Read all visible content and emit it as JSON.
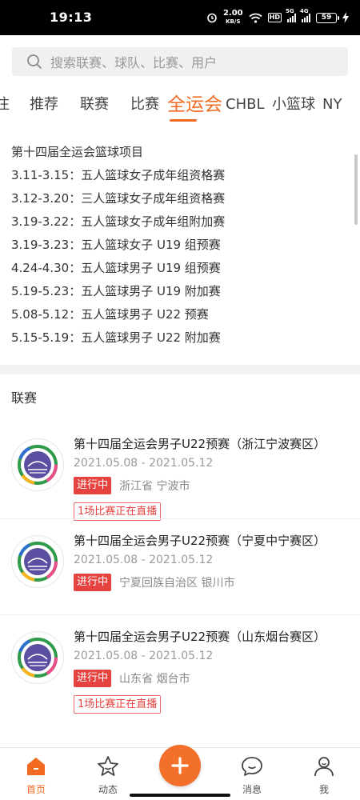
{
  "status_bar": {
    "time": "19:13",
    "speed_value": "2.00",
    "speed_unit": "KB/S",
    "hd": "HD",
    "sig1": "5G",
    "sig2": "4G",
    "battery": "59"
  },
  "search": {
    "placeholder": "搜索联赛、球队、比赛、用户"
  },
  "tabs": [
    {
      "label": "注",
      "active": false
    },
    {
      "label": "推荐",
      "active": false
    },
    {
      "label": "联赛",
      "active": false
    },
    {
      "label": "比赛",
      "active": false
    },
    {
      "label": "全运会",
      "active": true
    },
    {
      "label": "CHBL",
      "active": false
    },
    {
      "label": "小篮球",
      "active": false
    },
    {
      "label": "NY",
      "active": false
    }
  ],
  "schedule": [
    "第十四届全运会篮球项目",
    "3.11-3.15：五人篮球女子成年组资格赛",
    "3.12-3.20：三人篮球女子成年组资格赛",
    "3.19-3.22：五人篮球女子成年组附加赛",
    "3.19-3.23：五人篮球女子 U19 组预赛",
    "4.24-4.30：五人篮球男子 U19 组预赛",
    "5.19-5.23：五人篮球男子 U19 附加赛",
    "5.08-5.12：五人篮球男子 U22 预赛",
    "5.15-5.19：五人篮球男子 U22 附加赛"
  ],
  "section_title": "联赛",
  "leagues": [
    {
      "title": "第十四届全运会男子U22预赛（浙江宁波赛区）",
      "date": "2021.05.08 - 2021.05.12",
      "status": "进行中",
      "location": "浙江省 宁波市",
      "live": "1场比赛正在直播"
    },
    {
      "title": "第十四届全运会男子U22预赛（宁夏中宁赛区）",
      "date": "2021.05.08 - 2021.05.12",
      "status": "进行中",
      "location": "宁夏回族自治区 银川市",
      "live": ""
    },
    {
      "title": "第十四届全运会男子U22预赛（山东烟台赛区）",
      "date": "2021.05.08 - 2021.05.12",
      "status": "进行中",
      "location": "山东省 烟台市",
      "live": "1场比赛正在直播"
    }
  ],
  "bottom_nav": {
    "home": "首页",
    "feed": "动态",
    "messages": "消息",
    "me": "我"
  },
  "colors": {
    "accent": "#f26a21",
    "status_tag": "#e64340"
  }
}
